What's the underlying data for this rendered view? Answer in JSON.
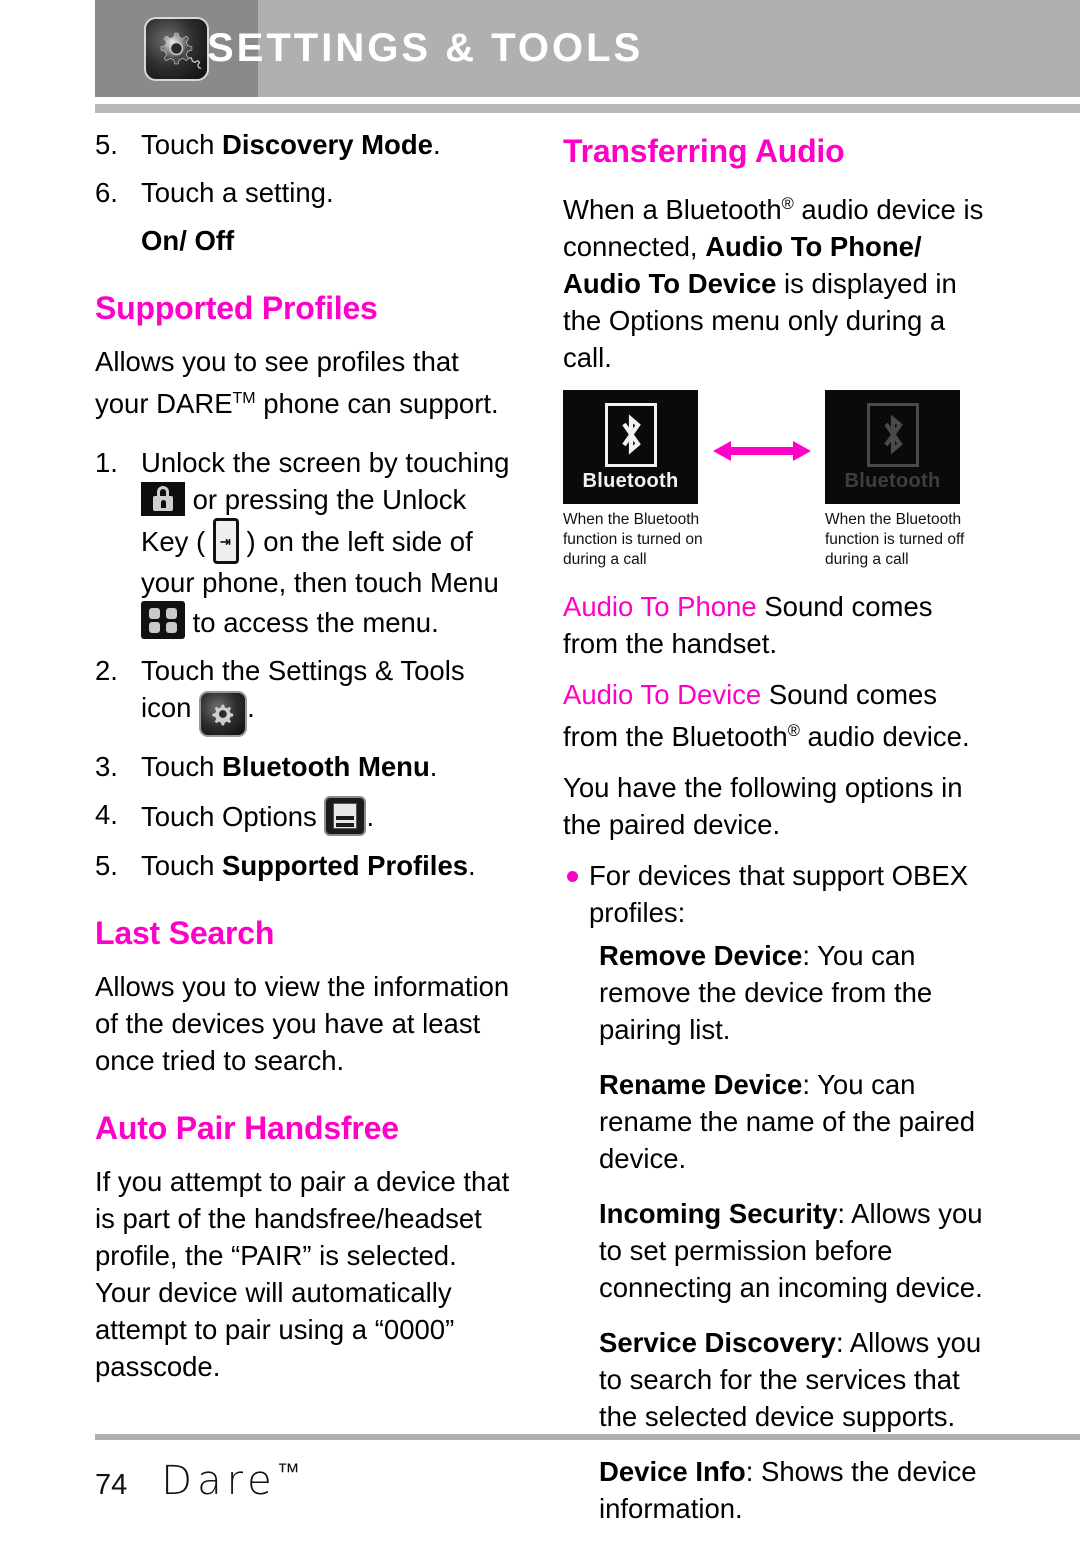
{
  "header": {
    "title": "SETTINGS & TOOLS",
    "icon": "settings-tools-gear-icon"
  },
  "left_column": {
    "steps_top": [
      {
        "num": "5.",
        "prefix": "Touch ",
        "bold": "Discovery Mode",
        "suffix": "."
      },
      {
        "num": "6.",
        "prefix": "Touch a setting.",
        "bold": "",
        "suffix": ""
      }
    ],
    "on_off": "On/ Off",
    "supported_profiles": {
      "heading": "Supported Profiles",
      "intro_a": "Allows you to see profiles that your DARE",
      "intro_tm": "TM",
      "intro_b": " phone can support.",
      "step1_num": "1.",
      "step1_a": "Unlock the screen by touching",
      "step1_b": " or pressing the Unlock Key",
      "step1_c": "( ",
      "step1_d": " ) on the left side of your phone, then touch Menu",
      "step1_e": " to access the menu.",
      "step2_num": "2.",
      "step2_a": "Touch the Settings & Tools icon",
      "step2_b": ".",
      "step3_num": "3.",
      "step3_a": "Touch ",
      "step3_bold": "Bluetooth Menu",
      "step3_b": ".",
      "step4_num": "4.",
      "step4_a": "Touch Options",
      "step4_b": ".",
      "step5_num": "5.",
      "step5_a": "Touch ",
      "step5_bold": "Supported Profiles",
      "step5_b": "."
    },
    "last_search": {
      "heading": "Last Search",
      "body": "Allows you to view the information of the devices you have at least once tried to search."
    },
    "auto_pair": {
      "heading": "Auto Pair Handsfree",
      "body": "If you attempt to pair a device that is part of the handsfree/headset profile, the “PAIR” is selected. Your device will automatically attempt to pair using a “0000” passcode."
    }
  },
  "right_column": {
    "transferring_audio": {
      "heading": "Transferring Audio",
      "intro_a": "When a Bluetooth",
      "intro_sup": "®",
      "intro_b": " audio device is connected, ",
      "intro_bold1": "Audio To Phone/ Audio To Device",
      "intro_c": " is displayed in the Options menu only during a call."
    },
    "figure": {
      "screen_on_label": "Bluetooth",
      "screen_off_label": "Bluetooth",
      "caption_left": "When the Bluetooth function is turned on during a call",
      "caption_right": "When the Bluetooth function is turned off during a call",
      "arrow_color": "#ff00c8"
    },
    "audio_to_phone": {
      "term": "Audio To Phone",
      "desc": " Sound comes from the handset."
    },
    "audio_to_device": {
      "term": "Audio To Device",
      "desc_a": " Sound comes from the Bluetooth",
      "desc_sup": "®",
      "desc_b": " audio device."
    },
    "options_intro": "You have the following options in the paired device.",
    "obex_bullet": "For devices that support OBEX profiles:",
    "options": [
      {
        "term": "Remove Device",
        "desc": ": You can remove the device from the pairing list."
      },
      {
        "term": "Rename Device",
        "desc": ": You can rename the name of the paired device."
      },
      {
        "term": "Incoming Security",
        "desc": ": Allows you to set permission before connecting an incoming device."
      },
      {
        "term": "Service Discovery",
        "desc": ": Allows you to search for the services that the selected device supports."
      },
      {
        "term": "Device Info",
        "desc": ": Shows the device information."
      }
    ]
  },
  "footer": {
    "page_number": "74",
    "brand": "Dare",
    "brand_tm": "™"
  },
  "colors": {
    "accent_magenta": "#ff00c8",
    "header_bar": "#b0b0b0",
    "header_icon_box": "#8a8a8a"
  }
}
